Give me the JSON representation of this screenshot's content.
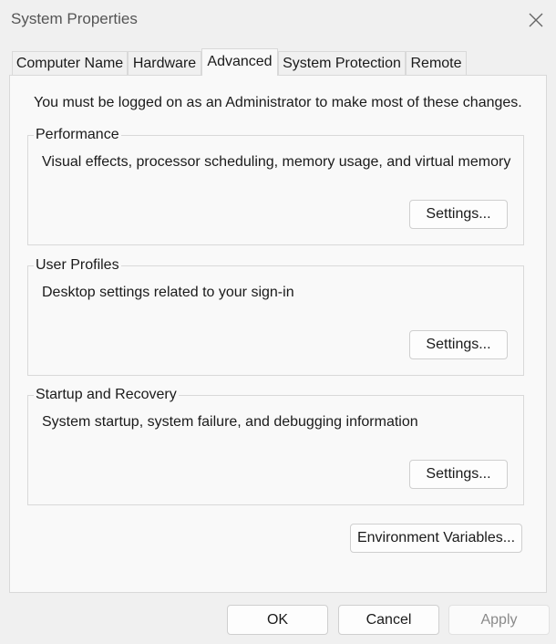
{
  "window": {
    "title": "System Properties",
    "close_icon": "close-icon"
  },
  "tabs": [
    {
      "label": "Computer Name"
    },
    {
      "label": "Hardware"
    },
    {
      "label": "Advanced",
      "active": true
    },
    {
      "label": "System Protection"
    },
    {
      "label": "Remote"
    }
  ],
  "advanced": {
    "notice": "You must be logged on as an Administrator to make most of these changes.",
    "groups": [
      {
        "title": "Performance",
        "description": "Visual effects, processor scheduling, memory usage, and virtual memory",
        "button": "Settings..."
      },
      {
        "title": "User Profiles",
        "description": "Desktop settings related to your sign-in",
        "button": "Settings..."
      },
      {
        "title": "Startup and Recovery",
        "description": "System startup, system failure, and debugging information",
        "button": "Settings..."
      }
    ],
    "env_button": "Environment Variables..."
  },
  "footer": {
    "ok": "OK",
    "cancel": "Cancel",
    "apply": "Apply",
    "apply_disabled": true
  }
}
